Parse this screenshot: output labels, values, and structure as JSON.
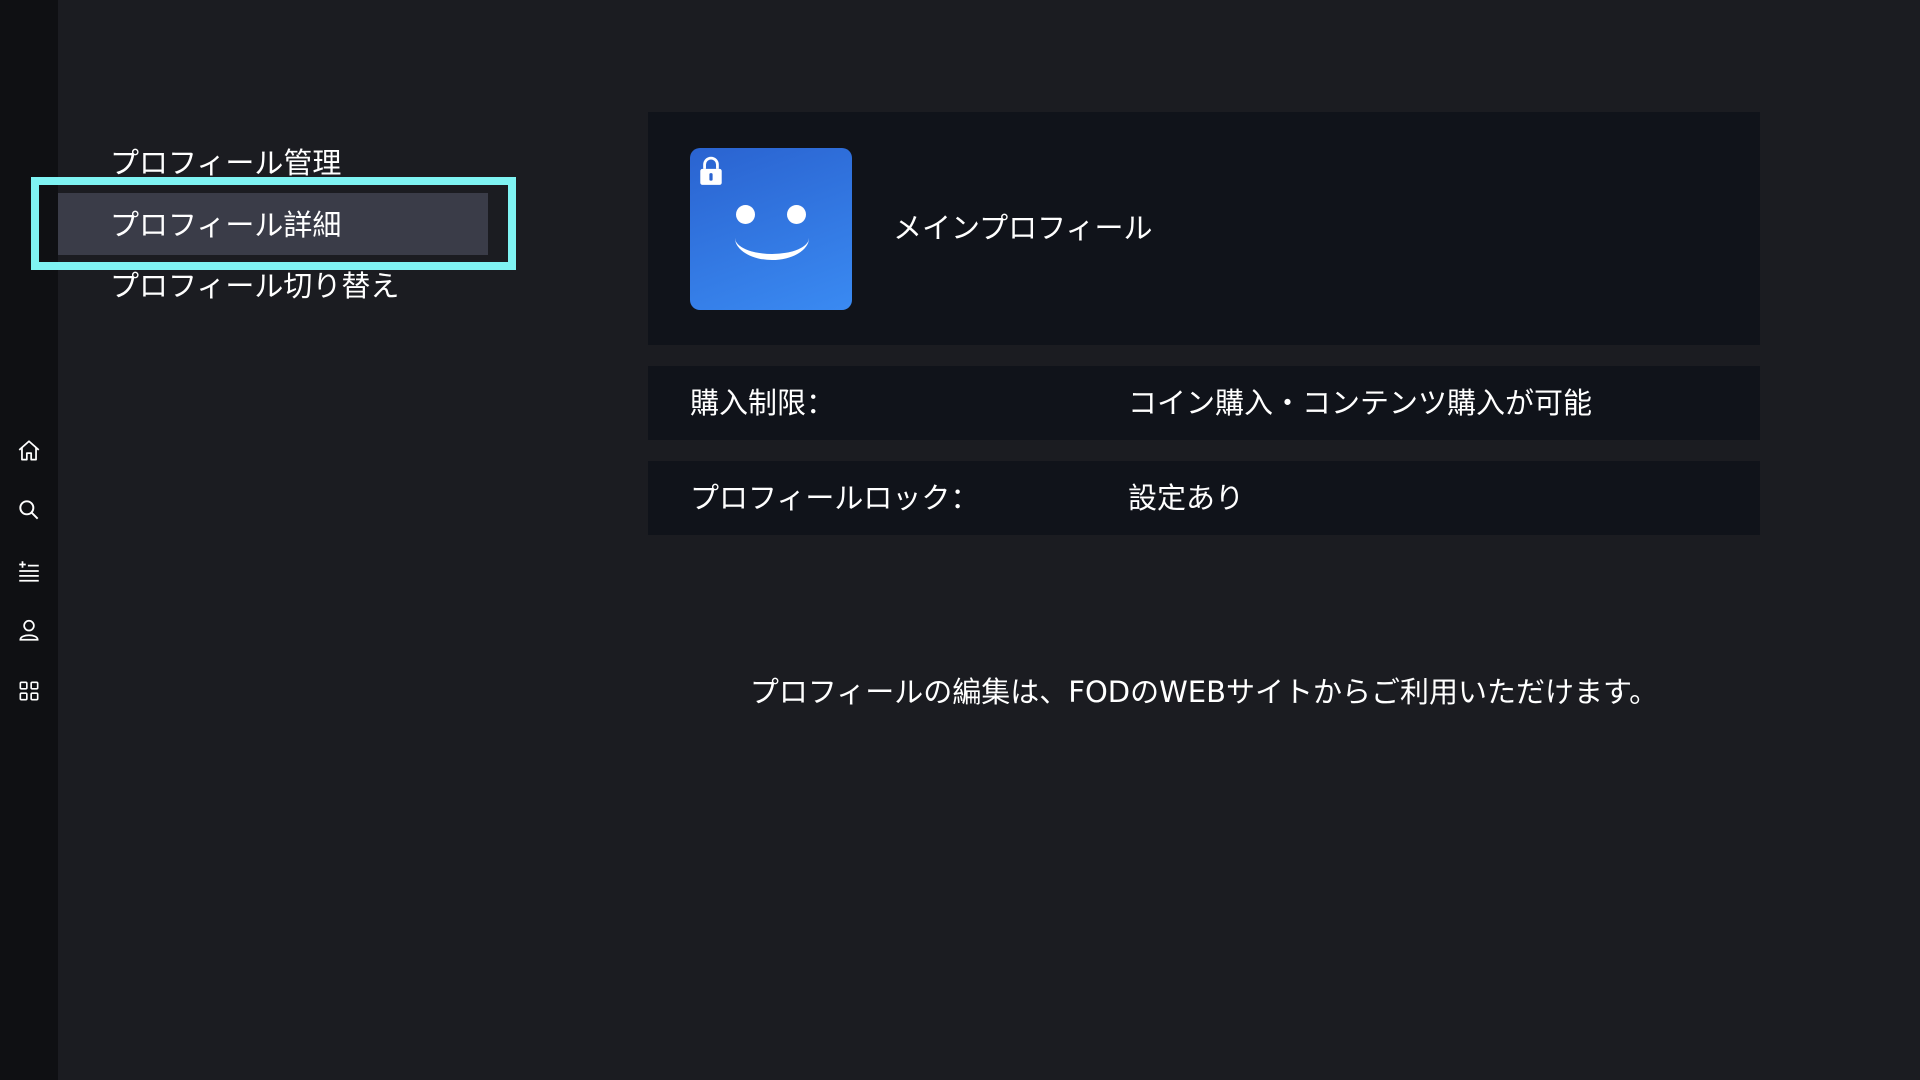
{
  "nav_rail": {
    "icons": [
      "home-icon",
      "search-icon",
      "mylist-icon",
      "account-icon",
      "apps-icon"
    ]
  },
  "menu": {
    "items": [
      {
        "label": "プロフィール管理",
        "focused": false
      },
      {
        "label": "プロフィール詳細",
        "focused": true
      },
      {
        "label": "プロフィール切り替え",
        "focused": false
      }
    ]
  },
  "profile": {
    "name": "メインプロフィール",
    "avatar_icon": "smiley-face-icon",
    "locked": true,
    "avatar_color": "#3480ea"
  },
  "details": [
    {
      "label": "購入制限：",
      "value": "コイン購入・コンテンツ購入が可能"
    },
    {
      "label": "プロフィールロック：",
      "value": "設定あり"
    }
  ],
  "notice": "プロフィールの編集は、FODのWEBサイトからご利用いただけます。",
  "colors": {
    "background": "#1b1c21",
    "rail": "#0f1013",
    "card": "#10131a",
    "focus_border": "#7ff3f3",
    "focus_fill": "#3a3c48"
  }
}
